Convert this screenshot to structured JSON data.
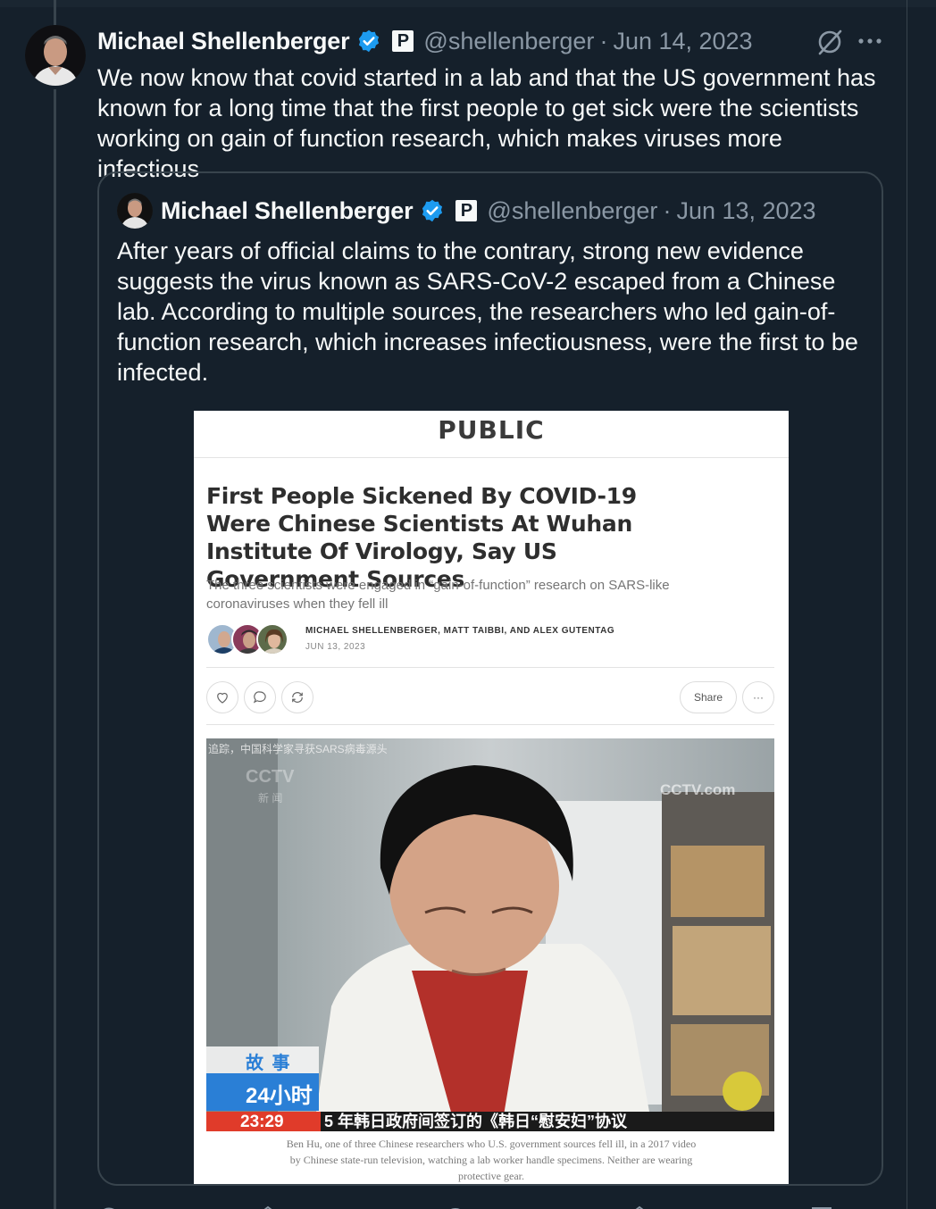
{
  "tweet": {
    "author_name": "Michael Shellenberger",
    "handle": "@shellenberger",
    "separator": "·",
    "date": "Jun 14, 2023",
    "badge_letter": "P",
    "text": "We now know that covid started in a lab and that the US government has known for a long time that the first people to get sick were the scientists working on gain of function research, which makes viruses more infectious"
  },
  "quoted_tweet": {
    "author_name": "Michael Shellenberger",
    "handle": "@shellenberger",
    "separator": "·",
    "date": "Jun 13, 2023",
    "badge_letter": "P",
    "text": "After years of official claims to the contrary, strong new evidence suggests the virus known as SARS-CoV-2 escaped from a Chinese lab. According to multiple sources, the researchers who led gain-of-function research, which increases infectiousness, were the first to be infected."
  },
  "article": {
    "publication": "PUBLIC",
    "headline": "First People Sickened By COVID-19 Were Chinese Scientists At Wuhan Institute Of Virology, Say US Government Sources",
    "subtitle": "The three scientists were engaged in “gain-of-function” research on SARS-like coronaviruses when they fell ill",
    "authors": "MICHAEL SHELLENBERGER, MATT TAIBBI, AND ALEX GUTENTAG",
    "date": "JUN 13, 2023",
    "share_label": "Share",
    "more_label": "···",
    "photo": {
      "top_caption": "追踪，中国科学家寻获SARS病毒源头",
      "channel_logo": "CCTV",
      "channel_sub": "新 闻",
      "watermark": "CCTV.com",
      "program_line1": "故 事",
      "program_line2": "24小时",
      "ticker_time": "23:29",
      "ticker_text": "5 年韩日政府间签订的《韩日“慰安妇”协议"
    },
    "caption": "Ben Hu, one of three Chinese researchers who U.S. government sources fell ill, in a 2017 video by Chinese state-run television, watching a lab worker handle specimens. Neither are wearing protective gear."
  },
  "colors": {
    "background": "#15202b",
    "text": "#f7f9f9",
    "muted": "#8b98a5",
    "border": "#38444d",
    "verified": "#1d9bf0"
  },
  "icons": [
    "verified-badge-icon",
    "grok-icon",
    "more-icon",
    "heart-icon",
    "comment-icon",
    "restack-icon",
    "ellipsis-icon"
  ]
}
